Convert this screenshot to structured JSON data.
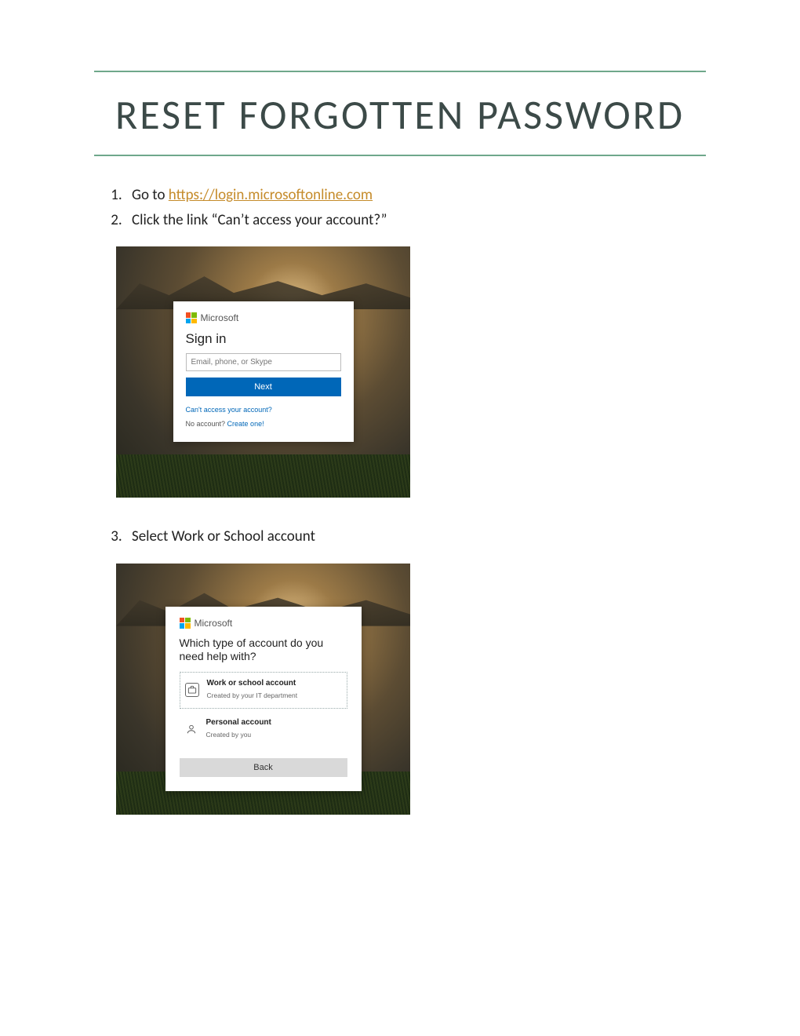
{
  "doc": {
    "title": "RESET FORGOTTEN PASSWORD",
    "steps": {
      "s1_prefix": "Go to ",
      "s1_link_text": "https://login.microsoftonline.com",
      "s1_link_href": "https://login.microsoftonline.com",
      "s2": "Click the link “Can’t access your account?”",
      "s3": "Select Work or School account"
    }
  },
  "signin": {
    "brand": "Microsoft",
    "heading": "Sign in",
    "placeholder": "Email, phone, or Skype",
    "next": "Next",
    "cant_access": "Can't access your account?",
    "no_account_prefix": "No account? ",
    "create_one": "Create one!"
  },
  "picker": {
    "brand": "Microsoft",
    "heading": "Which type of account do you need help with?",
    "work_title": "Work or school account",
    "work_sub": "Created by your IT department",
    "personal_title": "Personal account",
    "personal_sub": "Created by you",
    "back": "Back"
  }
}
